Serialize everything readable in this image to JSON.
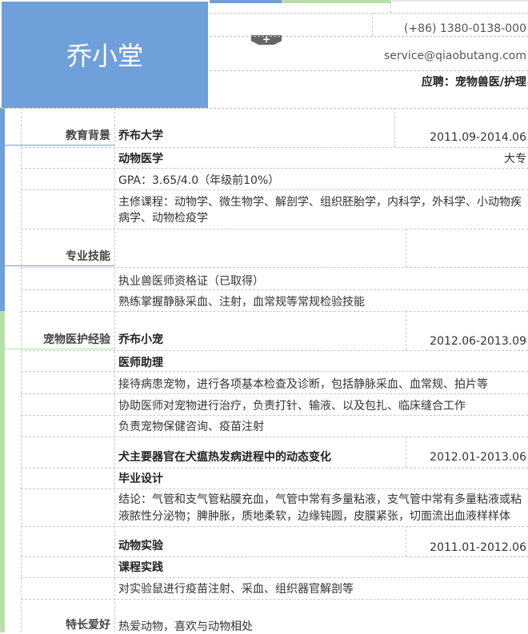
{
  "header": {
    "name": "乔小堂",
    "phone": "(+86) 1380-0138-000",
    "email": "service@qiaobutang.com",
    "objective": "应聘：宠物兽医/护理",
    "add_label": "+"
  },
  "education": {
    "label": "教育背景",
    "school": "乔布大学",
    "period": "2011.09-2014.06",
    "major": "动物医学",
    "degree": "大专",
    "gpa": "GPA：3.65/4.0（年级前10%）",
    "courses_line1": "主修课程：动物学、微生物学、解剖学、组织胚胎学，内科学，外科学、小动物疾",
    "courses_line2": "病学、动物检疫学"
  },
  "skills": {
    "label": "专业技能",
    "items": [
      "执业兽医师资格证（已取得）",
      "熟练掌握静脉采血、注射，血常规等常规检验技能"
    ]
  },
  "experience": {
    "label": "宠物医护经验",
    "org": "乔布小宠",
    "period": "2012.06-2013.09",
    "role": "医师助理",
    "duties": [
      "接待病患宠物，进行各项基本检查及诊断，包括静脉采血、血常规、拍片等",
      "协助医师对宠物进行治疗，负责打针、输液、以及包扎、临床缝合工作",
      "负责宠物保健咨询、疫苗注射"
    ],
    "project_title": "犬主要器官在犬瘟热发病进程中的动态变化",
    "project_period": "2012.01-2013.06",
    "project_type": "毕业设计",
    "conclusion_line1": "结论：气管和支气管粘膜充血，气管中常有多量粘液，支气管中常有多量粘液或粘",
    "conclusion_line2": "液脓性分泌物；脾肿胀，质地柔软，边缘钝圆，皮膜紧张，切面流出血液样样体",
    "lab_title": "动物实验",
    "lab_period": "2011.01-2012.06",
    "lab_type": "课程实践",
    "lab_detail": "对实验鼠进行疫苗注射、采血、组织器官解剖等"
  },
  "hobbies": {
    "label": "特长爱好",
    "text": "热爱动物，喜欢与动物相处"
  },
  "colors": {
    "blue": "#6fa0da",
    "green": "#b7e0a8",
    "grid": "#c8c8c8"
  }
}
